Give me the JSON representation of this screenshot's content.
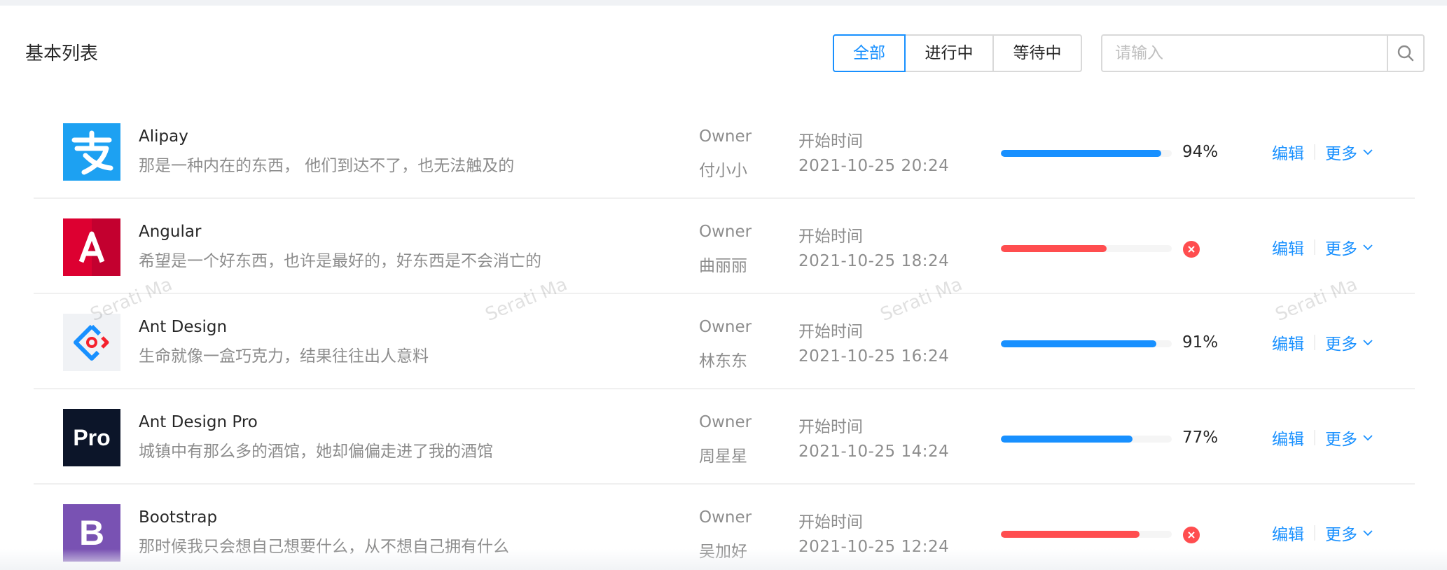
{
  "card": {
    "title": "基本列表"
  },
  "filters": {
    "all": "全部",
    "in_progress": "进行中",
    "waiting": "等待中",
    "selected": "全部"
  },
  "search": {
    "placeholder": "请输入",
    "value": ""
  },
  "watermark": "Serati Ma",
  "colors": {
    "primary": "#1890ff",
    "exception": "#ff4d4f",
    "alipay": "#1da1f2",
    "angular": "#dd0031",
    "antdesign_bg": "#f0f2f5",
    "antdesign_pro": "#0c1529",
    "bootstrap": "#7952b3"
  },
  "list": [
    {
      "title": "Alipay",
      "desc": "那是一种内在的东西， 他们到达不了，也无法触及的",
      "owner_label": "Owner",
      "owner": "付小小",
      "time_label": "开始时间",
      "time": "2021-10-25 20:24",
      "progress": 94,
      "progress_text": "94%",
      "status": "active",
      "logo_icon": "alipay-logo-icon",
      "edit": "编辑",
      "more": "更多"
    },
    {
      "title": "Angular",
      "desc": "希望是一个好东西，也许是最好的，好东西是不会消亡的",
      "owner_label": "Owner",
      "owner": "曲丽丽",
      "time_label": "开始时间",
      "time": "2021-10-25 18:24",
      "progress": 62,
      "progress_text": "",
      "status": "exception",
      "logo_icon": "angular-logo-icon",
      "edit": "编辑",
      "more": "更多"
    },
    {
      "title": "Ant Design",
      "desc": "生命就像一盒巧克力，结果往往出人意料",
      "owner_label": "Owner",
      "owner": "林东东",
      "time_label": "开始时间",
      "time": "2021-10-25 16:24",
      "progress": 91,
      "progress_text": "91%",
      "status": "active",
      "logo_icon": "ant-design-logo-icon",
      "edit": "编辑",
      "more": "更多"
    },
    {
      "title": "Ant Design Pro",
      "desc": "城镇中有那么多的酒馆，她却偏偏走进了我的酒馆",
      "owner_label": "Owner",
      "owner": "周星星",
      "time_label": "开始时间",
      "time": "2021-10-25 14:24",
      "progress": 77,
      "progress_text": "77%",
      "status": "active",
      "logo_icon": "ant-design-pro-logo-icon",
      "logo_text": "Pro",
      "edit": "编辑",
      "more": "更多"
    },
    {
      "title": "Bootstrap",
      "desc": "那时候我只会想自己想要什么，从不想自己拥有什么",
      "owner_label": "Owner",
      "owner": "吴加好",
      "time_label": "开始时间",
      "time": "2021-10-25 12:24",
      "progress": 81,
      "progress_text": "",
      "status": "exception",
      "logo_icon": "bootstrap-logo-icon",
      "logo_text": "B",
      "edit": "编辑",
      "more": "更多"
    }
  ]
}
